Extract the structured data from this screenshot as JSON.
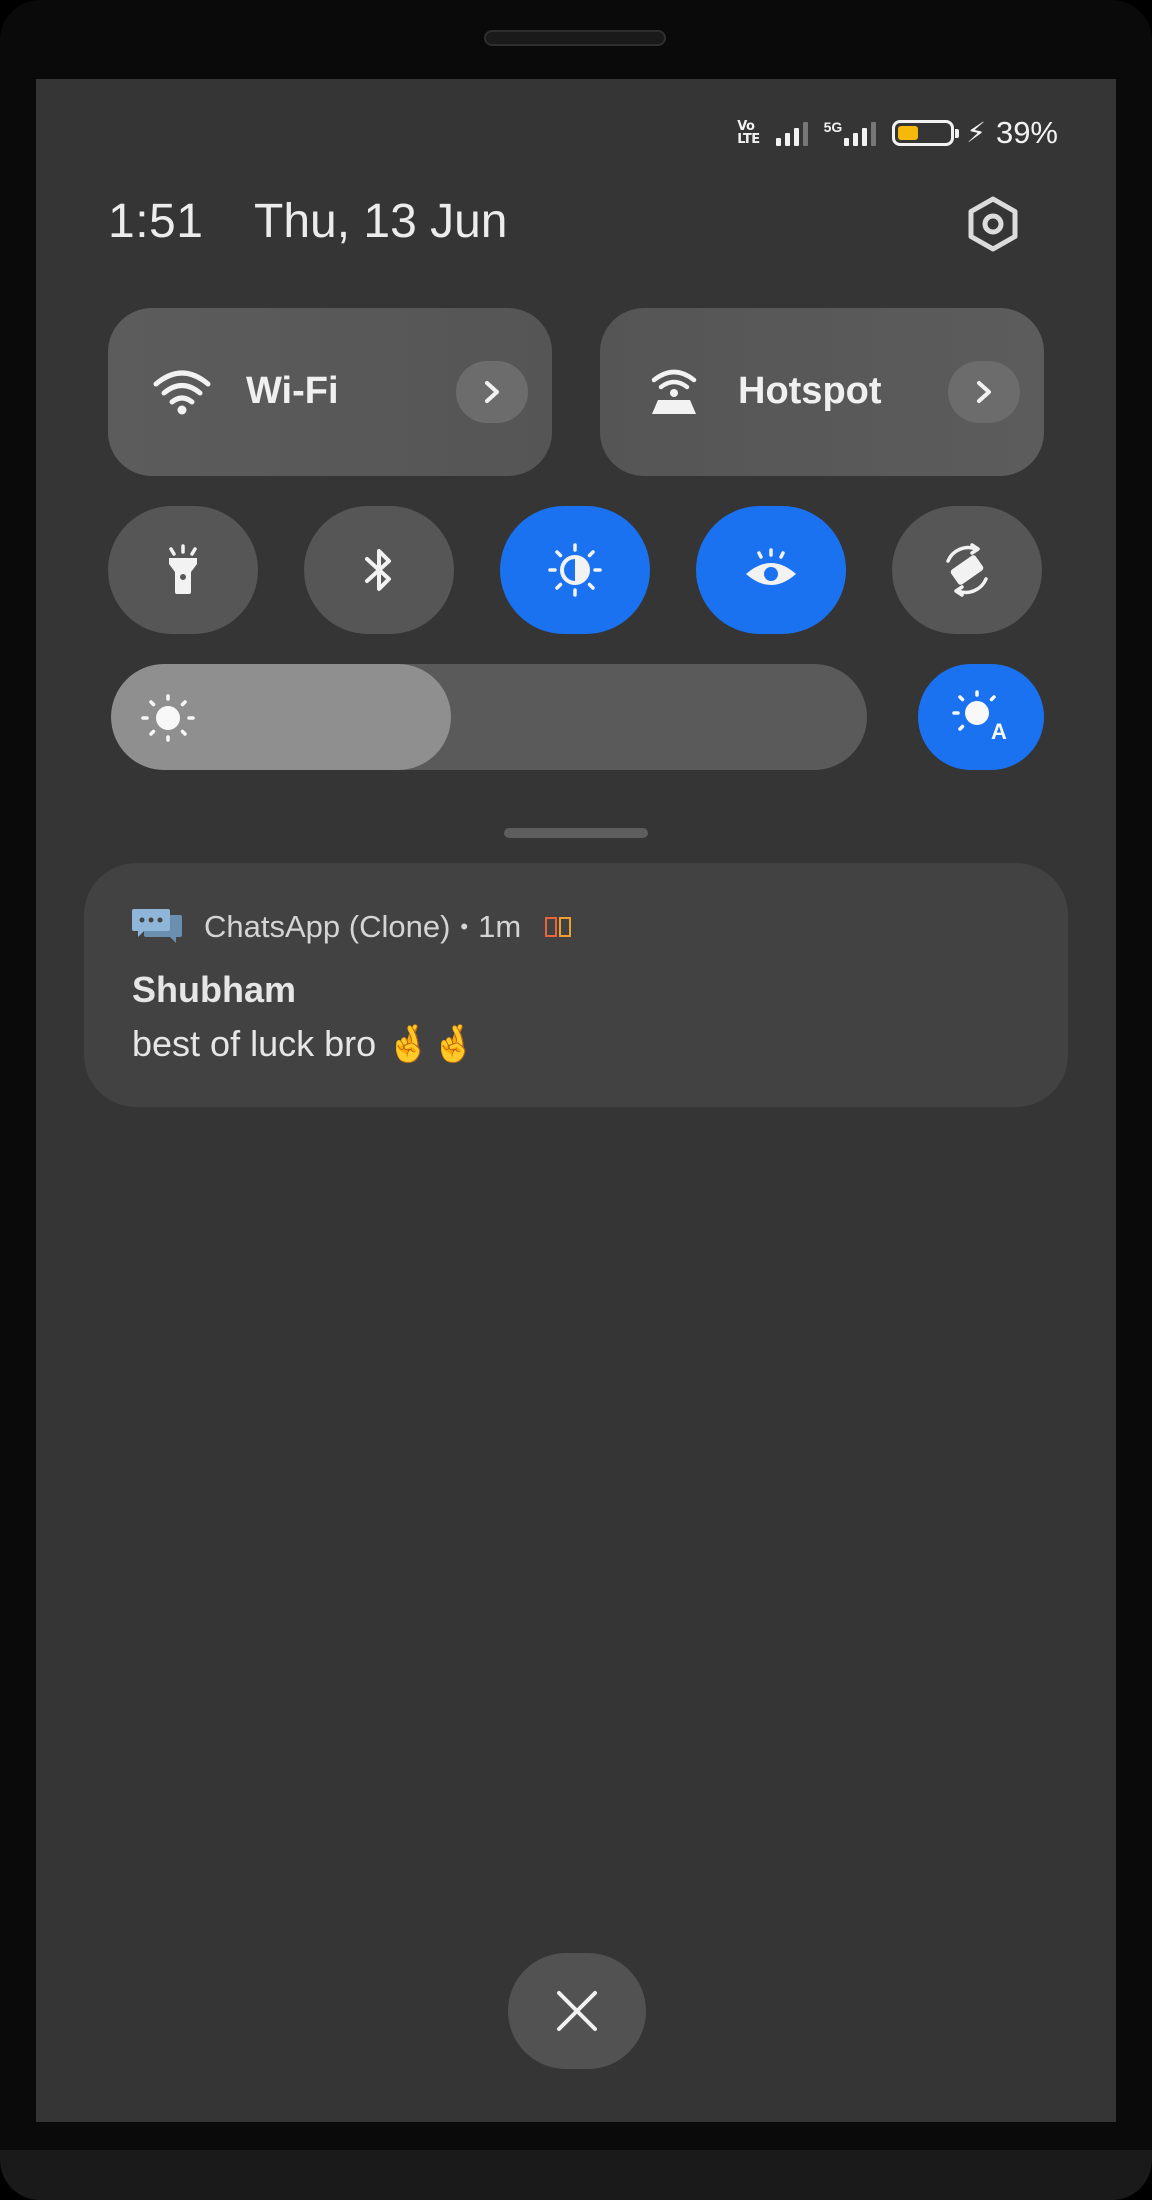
{
  "status_bar": {
    "network_type": "VoLTE",
    "volte_text_top": "Vo",
    "volte_text_bottom": "LTE",
    "sim_label": "5G",
    "battery_percent": "39%",
    "battery_level": 0.39,
    "charging": true
  },
  "header": {
    "time": "1:51",
    "date": "Thu, 13 Jun"
  },
  "tiles": [
    {
      "label": "Wi-Fi",
      "icon": "wifi-icon"
    },
    {
      "label": "Hotspot",
      "icon": "hotspot-icon"
    }
  ],
  "toggles": [
    {
      "name": "flashlight",
      "icon": "flashlight-icon",
      "on": false
    },
    {
      "name": "bluetooth",
      "icon": "bluetooth-icon",
      "on": false
    },
    {
      "name": "dark-mode",
      "icon": "contrast-icon",
      "on": true
    },
    {
      "name": "eye-comfort",
      "icon": "eye-icon",
      "on": true
    },
    {
      "name": "auto-rotate",
      "icon": "rotate-icon",
      "on": false
    }
  ],
  "brightness": {
    "level": 0.45,
    "auto_label": "A"
  },
  "notification": {
    "app_name": "ChatsApp (Clone)",
    "separator": "•",
    "age": "1m",
    "sender": "Shubham",
    "message": "best of luck bro 🤞🤞"
  },
  "colors": {
    "accent": "#1a72f0",
    "panel_bg": "#353535",
    "battery_fill": "#f6b80a"
  }
}
